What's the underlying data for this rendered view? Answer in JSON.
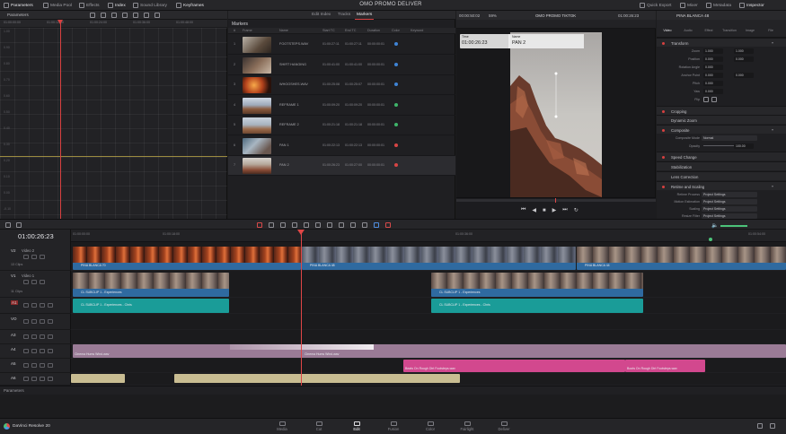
{
  "topbar": {
    "project_title": "OMO PROMO DELIVER",
    "items": {
      "parameters": "Parameters",
      "media_pool": "Media Pool",
      "effects": "Effects",
      "index": "Index",
      "sound_library": "Sound Library",
      "keyframes": "Keyframes",
      "quick_export": "Quick Export",
      "mixer": "Mixer",
      "metadata": "Metadata",
      "inspector": "Inspector"
    }
  },
  "curve_editor": {
    "label": "Parameters",
    "ruler": [
      "01:00:00:00",
      "01:00:12:00",
      "01:00:24:00",
      "01:00:36:00",
      "01:00:48:00"
    ],
    "values": [
      "1.00",
      "0.90",
      "0.80",
      "0.70",
      "0.60",
      "0.50",
      "0.40",
      "0.30",
      "0.20",
      "0.10",
      "0.00",
      "-0.10"
    ]
  },
  "markers": {
    "title": "Markers",
    "tabs": [
      "Edit Index",
      "Tracks",
      "Markers"
    ],
    "headers": [
      "#",
      "Frame",
      "Name",
      "Start TC",
      "End TC",
      "Duration",
      "Color",
      "Keyword"
    ],
    "rows": [
      {
        "num": "1",
        "name": "FOOTSTEPS.WAV",
        "start": "01:00:27:11",
        "end": "01:00:27:11",
        "dur": "00:00:00:01",
        "color": "#3f84d6"
      },
      {
        "num": "2",
        "name": "SHIRT HANGING",
        "start": "01:00:41:00",
        "end": "01:00:41:00",
        "dur": "00:00:00:01",
        "color": "#3f84d6"
      },
      {
        "num": "3",
        "name": "WHOOSHES.WAV",
        "start": "01:00:25:08",
        "end": "01:00:25:07",
        "dur": "00:00:00:01",
        "color": "#3f84d6"
      },
      {
        "num": "4",
        "name": "REFRAME 1",
        "start": "01:00:09:20",
        "end": "01:00:09:20",
        "dur": "00:00:00:01",
        "color": "#3fb56a"
      },
      {
        "num": "5",
        "name": "REFRAME 2",
        "start": "01:00:21:18",
        "end": "01:00:21:18",
        "dur": "00:00:00:01",
        "color": "#3fb56a"
      },
      {
        "num": "6",
        "name": "PAN 1",
        "start": "01:00:22:13",
        "end": "01:00:22:13",
        "dur": "00:00:00:01",
        "color": "#d84545"
      },
      {
        "num": "7",
        "name": "PAN 2",
        "start": "01:00:26:23",
        "end": "01:00:27:00",
        "dur": "00:00:00:01",
        "color": "#d84545"
      }
    ]
  },
  "viewer": {
    "timecode": "00:00:50:02",
    "zoom": "59%",
    "timeline_name": "OMO PROMO TIKTOK",
    "playhead_tc": "01:00:26:23",
    "overlay_tc_label": "Time",
    "overlay_tc": "01:00:26:23",
    "overlay_name_label": "Name",
    "overlay_name": "PAN 2"
  },
  "inspector": {
    "clip_name": "PINA BLANCA 48",
    "tabs": [
      "Video",
      "Audio",
      "Effect",
      "Transition",
      "Image",
      "File"
    ],
    "transform": {
      "title": "Transform",
      "zoom_label": "Zoom",
      "zoom_x": "1.000",
      "zoom_y": "1.000",
      "position_label": "Position",
      "pos_x": "0.000",
      "pos_y": "0.000",
      "rotation_label": "Rotation Angle",
      "rotation": "0.000",
      "anchor_label": "Anchor Point",
      "anchor_x": "0.000",
      "anchor_y": "0.000",
      "pitch_label": "Pitch",
      "pitch": "0.000",
      "yaw_label": "Yaw",
      "yaw": "0.000",
      "flip_label": "Flip"
    },
    "sections": [
      "Cropping",
      "Dynamic Zoom",
      "Composite",
      "Speed Change",
      "Stabilization",
      "Lens Correction",
      "Retime and Scaling"
    ],
    "composite_mode_label": "Composite Mode",
    "composite_mode": "Normal",
    "opacity_label": "Opacity",
    "opacity": "100.00",
    "retime_process_label": "Retime Process",
    "retime_process": "Project Settings",
    "motion_estimation_label": "Motion Estimation",
    "motion_estimation": "Project Settings",
    "scaling_label": "Scaling",
    "scaling": "Project Settings",
    "resize_filter_label": "Resize Filter",
    "resize_filter": "Project Settings"
  },
  "timeline": {
    "timecode": "01:00:26:23",
    "ruler": [
      "01:00:00:00",
      "01:00:18:00",
      "01:00:36:00",
      "01:00:54:00"
    ],
    "tracks": [
      {
        "id": "V2",
        "name": "Video 2",
        "count": "13 Clips"
      },
      {
        "id": "V1",
        "name": "Video 1",
        "count": "11 Clips"
      },
      {
        "id": "A1",
        "name": "",
        "count": ""
      },
      {
        "id": "VO",
        "name": "",
        "count": ""
      },
      {
        "id": "A3",
        "name": "",
        "count": ""
      },
      {
        "id": "A4",
        "name": "",
        "count": ""
      },
      {
        "id": "A5",
        "name": "",
        "count": ""
      },
      {
        "id": "A6",
        "name": "",
        "count": ""
      }
    ],
    "clips": {
      "v2_a": "PINA BLANCA 70",
      "v2_b": "PINA BLANCA 48",
      "v2_c": "PINA BLANCA 44",
      "v1_a": "CL SUBCLIP 1 - Experiences",
      "v1_b": "CL SUBCLIP 1 - Experiences",
      "a1_a": "CL SUBCLIP 1 - Experiences - Chris",
      "a1_b": "CL SUBCLIP 1 - Experiences - Chris",
      "a4_a": "Cinema Hums Wind.wav",
      "a4_b": "Cinema Hums Wind.wav",
      "a5_a": "Beats On Rough Dirt Footsteps.wav",
      "a5_b": "Boots On Rough Dirt Footsteps.wav"
    }
  },
  "params_label": "Parameters",
  "app": {
    "name": "DaVinci Resolve 20"
  },
  "pages": [
    "Media",
    "Cut",
    "Edit",
    "Fusion",
    "Color",
    "Fairlight",
    "Deliver"
  ]
}
